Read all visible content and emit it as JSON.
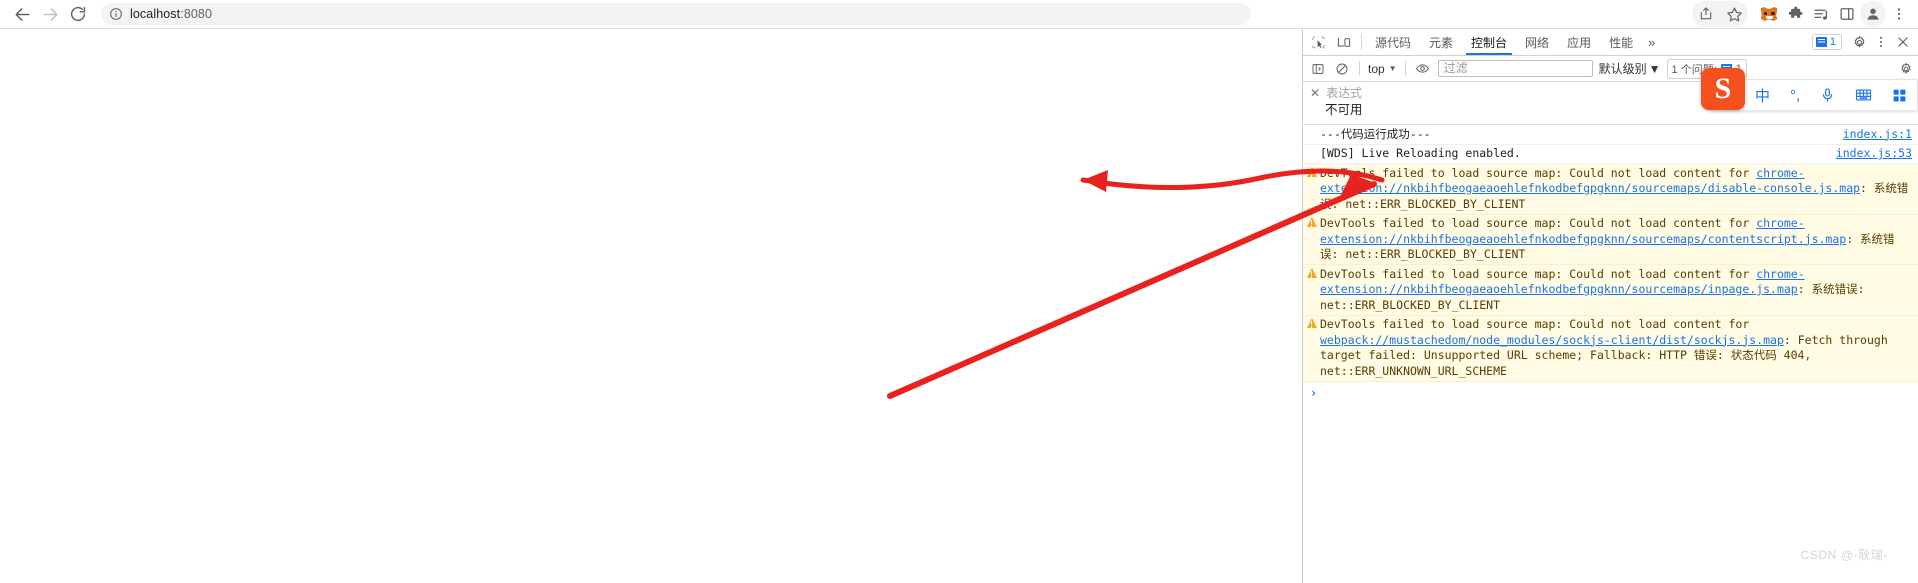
{
  "browser": {
    "nav": {
      "back_label": "后退",
      "forward_label": "前进",
      "reload_label": "重新加载"
    },
    "omnibox": {
      "url_host": "localhost",
      "url_port": ":8080",
      "site_info_label": "查看网站信息"
    },
    "actions": [
      {
        "name": "share-icon",
        "label": "分享"
      },
      {
        "name": "bookmark-icon",
        "label": "为此标签页添加书签"
      },
      {
        "name": "metamask-icon",
        "label": "MetaMask"
      },
      {
        "name": "extensions-icon",
        "label": "扩展程序"
      },
      {
        "name": "media-icon",
        "label": "媒体控件"
      },
      {
        "name": "sidepanel-icon",
        "label": "侧边栏"
      },
      {
        "name": "profile-icon",
        "label": "个人资料"
      },
      {
        "name": "menu-icon",
        "label": "自定义及控制"
      }
    ]
  },
  "devtools": {
    "tools": {
      "inspect_label": "检查",
      "device_label": "设备工具栏"
    },
    "tabs": [
      {
        "label": "源代码",
        "active": false
      },
      {
        "label": "元素",
        "active": false
      },
      {
        "label": "控制台",
        "active": true
      },
      {
        "label": "网络",
        "active": false
      },
      {
        "label": "应用",
        "active": false
      },
      {
        "label": "性能",
        "active": false
      }
    ],
    "more_tabs_label": "»",
    "issues_badge": {
      "count": "1"
    },
    "settings_label": "设置",
    "more_options_label": "更多选项",
    "close_label": "关闭 DevTools",
    "console_toolbar": {
      "sidebar_label": "显示控制台边栏",
      "clear_label": "清除控制台",
      "context": "top",
      "context_caret": "▼",
      "eye_label": "实时表达式",
      "filter_placeholder": "过滤",
      "filter_value": "",
      "level": "默认级别",
      "level_caret": "▼",
      "issues_text": "1 个问题:",
      "issues_count": "1",
      "settings_label": "控制台设置"
    },
    "watch": {
      "close_label": "✕",
      "title": "表达式",
      "value": "不可用"
    },
    "messages": [
      {
        "kind": "log",
        "text": "---代码运行成功---",
        "source": "index.js:1"
      },
      {
        "kind": "log",
        "text": "[WDS] Live Reloading enabled.",
        "source": "index.js:53"
      },
      {
        "kind": "warn",
        "text_pre": "DevTools failed to load source map: Could not load content for ",
        "link": "chrome-extension://nkbihfbeogaeaoehlefnkodbefgpgknn/sourcemaps/disable-console.js.map",
        "text_post": ": 系统错误: net::ERR_BLOCKED_BY_CLIENT",
        "source": ""
      },
      {
        "kind": "warn",
        "text_pre": "DevTools failed to load source map: Could not load content for ",
        "link": "chrome-extension://nkbihfbeogaeaoehlefnkodbefgpgknn/sourcemaps/contentscript.js.map",
        "text_post": ": 系统错误: net::ERR_BLOCKED_BY_CLIENT",
        "source": ""
      },
      {
        "kind": "warn",
        "text_pre": "DevTools failed to load source map: Could not load content for ",
        "link": "chrome-extension://nkbihfbeogaeaoehlefnkodbefgpgknn/sourcemaps/inpage.js.map",
        "text_post": ": 系统错误: net::ERR_BLOCKED_BY_CLIENT",
        "source": ""
      },
      {
        "kind": "warn",
        "text_pre": "DevTools failed to load source map: Could not load content for ",
        "link": "webpack://mustachedom/node_modules/sockjs-client/dist/sockjs.js.map",
        "text_post": ": Fetch through target failed: Unsupported URL scheme; Fallback: HTTP 错误: 状态代码 404, net::ERR_UNKNOWN_URL_SCHEME",
        "source": ""
      }
    ],
    "prompt": {
      "chevron": "›",
      "value": ""
    }
  },
  "ime": {
    "logo": "S",
    "items": [
      {
        "name": "ime-mode-chinese",
        "glyph": "中"
      },
      {
        "name": "ime-punctuation",
        "glyph": "°,"
      },
      {
        "name": "ime-voice-icon",
        "glyph": ""
      },
      {
        "name": "ime-keyboard-icon",
        "glyph": ""
      },
      {
        "name": "ime-apps-icon",
        "glyph": ""
      }
    ]
  },
  "annotation": {
    "color": "#e8231f",
    "description": "红色箭头指向 [WDS] Live Reloading enabled."
  },
  "watermark": "CSDN @-耿瑞-"
}
